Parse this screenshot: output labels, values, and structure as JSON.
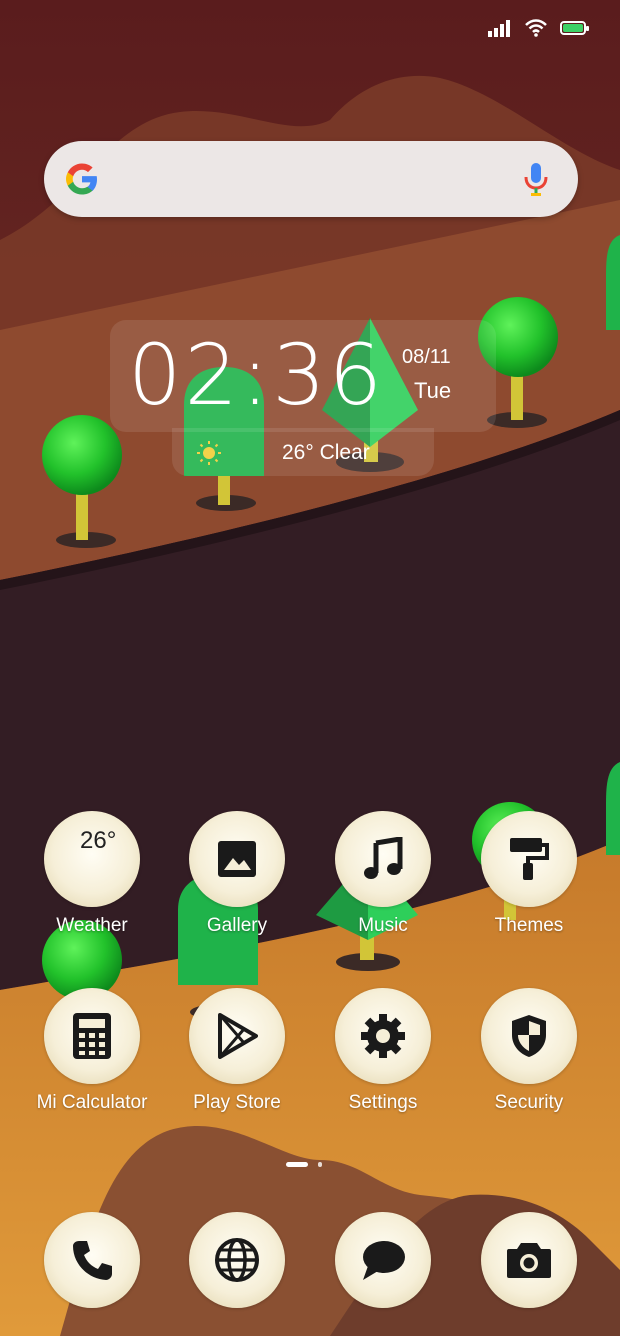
{
  "status_bar": {
    "signal_icon": "signal-icon",
    "wifi_icon": "wifi-icon",
    "battery_icon": "battery-icon",
    "battery_level": 1.0,
    "battery_color": "#3dd166"
  },
  "search_bar": {
    "logo": "google-g-logo",
    "mic_icon": "mic-icon"
  },
  "clock_widget": {
    "time": "02:36",
    "date": "08/11",
    "day": "Tue",
    "weather_icon": "sun-icon",
    "weather": "26° Clear"
  },
  "apps_row1": [
    {
      "label": "Weather",
      "icon": "weather-icon",
      "icon_text": "26°"
    },
    {
      "label": "Gallery",
      "icon": "gallery-icon"
    },
    {
      "label": "Music",
      "icon": "music-note-icon"
    },
    {
      "label": "Themes",
      "icon": "paint-roller-icon"
    }
  ],
  "apps_row2": [
    {
      "label": "Mi Calculator",
      "icon": "calculator-icon"
    },
    {
      "label": "Play Store",
      "icon": "play-store-icon"
    },
    {
      "label": "Settings",
      "icon": "gear-icon"
    },
    {
      "label": "Security",
      "icon": "shield-icon"
    }
  ],
  "dock": [
    {
      "icon": "phone-icon"
    },
    {
      "icon": "globe-icon"
    },
    {
      "icon": "chat-bubble-icon"
    },
    {
      "icon": "camera-icon"
    }
  ],
  "page_indicator": {
    "pages": 2,
    "active": 1
  }
}
